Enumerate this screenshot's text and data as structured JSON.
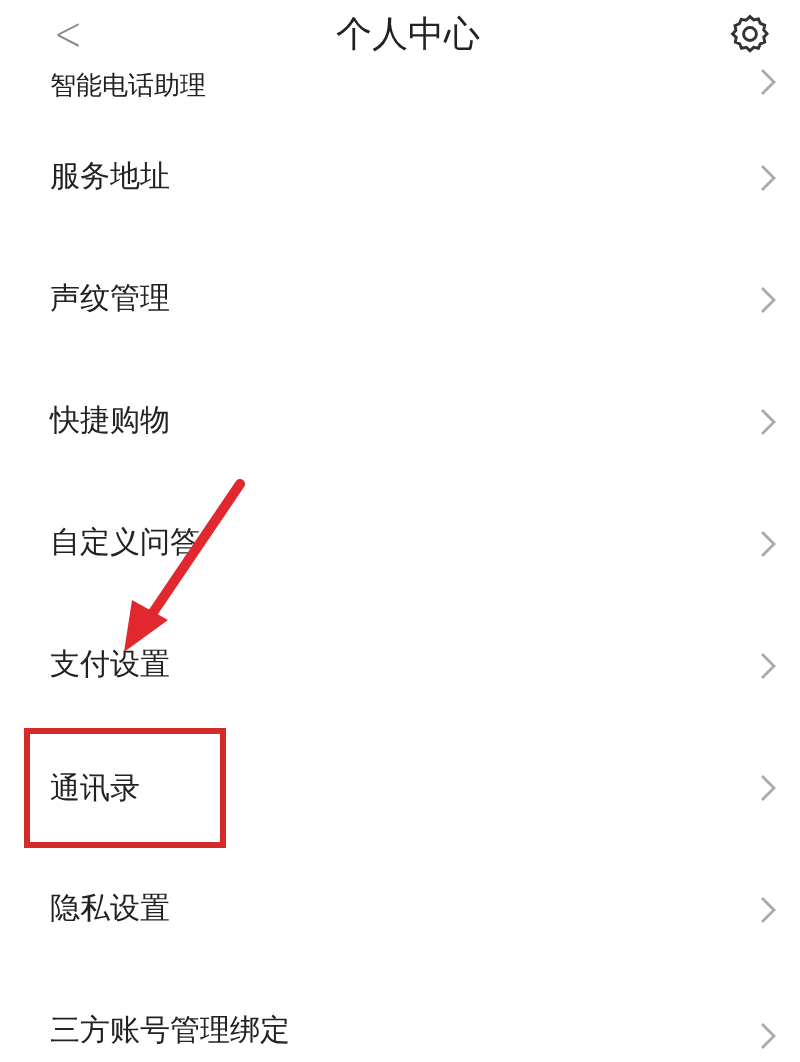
{
  "header": {
    "back": "<",
    "title": "个人中心"
  },
  "items": [
    {
      "label": "智能电话助理",
      "highlighted": false
    },
    {
      "label": "服务地址",
      "highlighted": false
    },
    {
      "label": "声纹管理",
      "highlighted": false
    },
    {
      "label": "快捷购物",
      "highlighted": false
    },
    {
      "label": "自定义问答",
      "highlighted": false
    },
    {
      "label": "支付设置",
      "highlighted": false
    },
    {
      "label": "通讯录",
      "highlighted": true
    },
    {
      "label": "隐私设置",
      "highlighted": false
    },
    {
      "label": "三方账号管理绑定",
      "highlighted": false
    }
  ],
  "annotation_arrow": true
}
